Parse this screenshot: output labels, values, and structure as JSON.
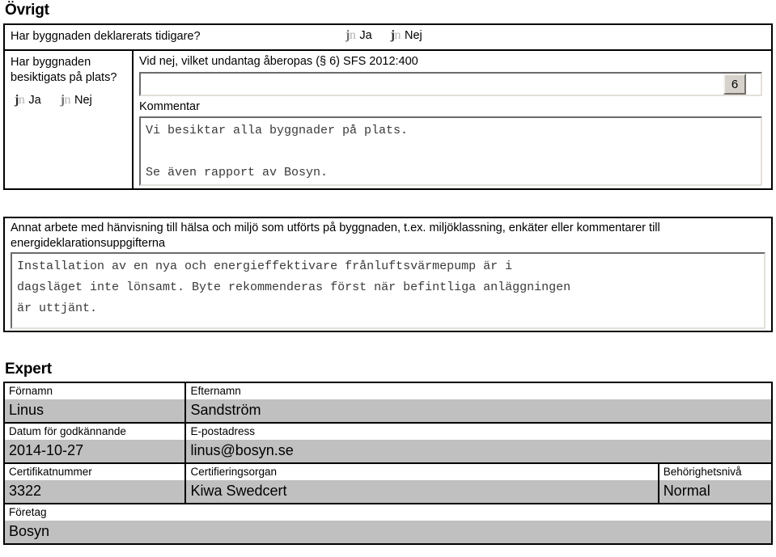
{
  "document": {
    "language": "sv",
    "page_background": "#ffffff",
    "value_fill_color": "#c0c0c0",
    "border_color": "#000000"
  },
  "ovrigt": {
    "heading": "Övrigt",
    "declared_before": {
      "question": "Har byggnaden deklarerats tidigare?",
      "options": [
        {
          "label": "Ja",
          "selected": false
        },
        {
          "label": "Nej",
          "selected": true
        }
      ]
    },
    "inspected_on_site": {
      "question_line_1": "Har byggnaden",
      "question_line_2": "besiktigats på plats?",
      "options": [
        {
          "label": "Ja",
          "selected": true
        },
        {
          "label": "Nej",
          "selected": false
        }
      ]
    },
    "exemption": {
      "label": "Vid nej, vilket undantag åberopas (§ 6) SFS 2012:400",
      "value": "",
      "placeholder": "",
      "side_button_label": "6"
    },
    "comment": {
      "label": "Kommentar",
      "value": "Vi besiktar alla byggnader på plats.\n\nSe även rapport av Bosyn.",
      "placeholder": ""
    }
  },
  "annat_arbete": {
    "label_line_1": "Annat arbete med hänvisning till hälsa och miljö som utförts på byggnaden, t.ex. miljöklassning, enkäter eller kommentarer till",
    "label_line_2": "energideklarationsuppgifterna",
    "value": "Installation av en nya och energieffektivare frånluftsvärmepump är i\ndagsläget inte lönsamt. Byte rekommenderas först när befintliga anläggningen\när uttjänt.",
    "placeholder": ""
  },
  "expert": {
    "heading": "Expert",
    "rows": [
      [
        {
          "label": "Förnamn",
          "value": "Linus"
        },
        {
          "label": "Efternamn",
          "value": "Sandström"
        }
      ],
      [
        {
          "label": "Datum för godkännande",
          "value": "2014-10-27"
        },
        {
          "label": "E-postadress",
          "value": "linus@bosyn.se"
        }
      ],
      [
        {
          "label": "Certifikatnummer",
          "value": "3322"
        },
        {
          "label": "Certifieringsorgan",
          "value": "Kiwa Swedcert"
        },
        {
          "label": "Behörighetsnivå",
          "value": "Normal"
        }
      ],
      [
        {
          "label": "Företag",
          "value": "Bosyn"
        }
      ]
    ]
  }
}
